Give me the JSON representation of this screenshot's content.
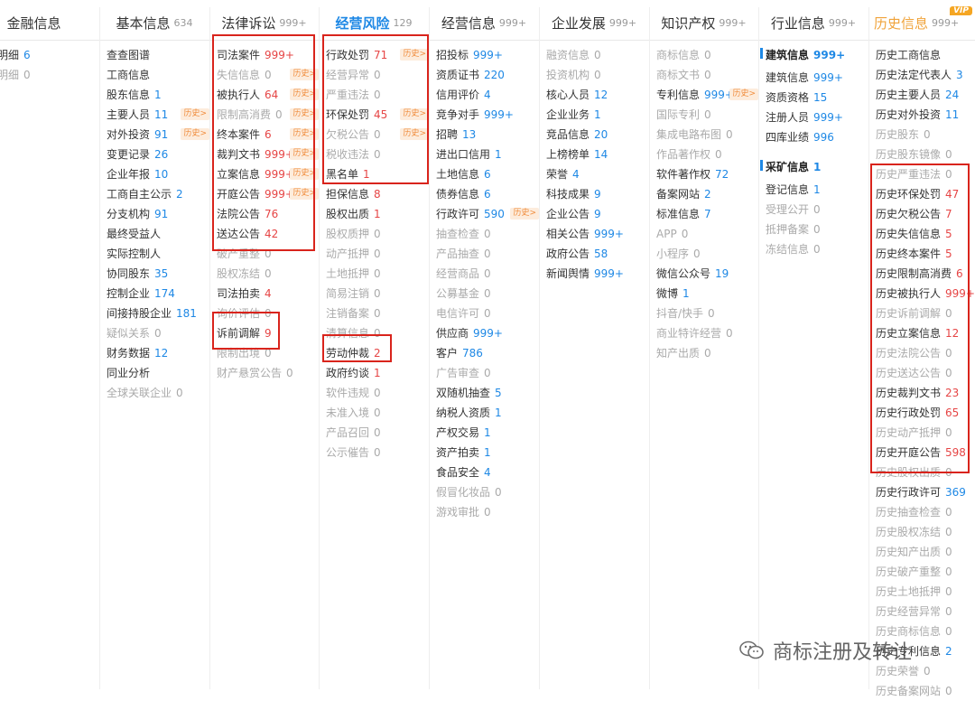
{
  "tabs": [
    {
      "label": "金融信息",
      "count": "",
      "active": false,
      "hist": false,
      "vip": ""
    },
    {
      "label": "基本信息",
      "count": "634",
      "active": false,
      "hist": false,
      "vip": ""
    },
    {
      "label": "法律诉讼",
      "count": "999+",
      "active": false,
      "hist": false,
      "vip": ""
    },
    {
      "label": "经营风险",
      "count": "129",
      "active": true,
      "hist": false,
      "vip": ""
    },
    {
      "label": "经营信息",
      "count": "999+",
      "active": false,
      "hist": false,
      "vip": ""
    },
    {
      "label": "企业发展",
      "count": "999+",
      "active": false,
      "hist": false,
      "vip": ""
    },
    {
      "label": "知识产权",
      "count": "999+",
      "active": false,
      "hist": false,
      "vip": ""
    },
    {
      "label": "行业信息",
      "count": "999+",
      "active": false,
      "hist": false,
      "vip": ""
    },
    {
      "label": "历史信息",
      "count": "999+",
      "active": false,
      "hist": true,
      "vip": "VIP"
    }
  ],
  "columns": [
    [
      {
        "name": "债券明细",
        "num": "6",
        "tone": "blue"
      },
      {
        "name": "违约明细",
        "num": "0",
        "dim": true
      }
    ],
    [
      {
        "name": "查查图谱"
      },
      {
        "name": "工商信息"
      },
      {
        "name": "股东信息",
        "num": "1",
        "tone": "blue"
      },
      {
        "name": "主要人员",
        "num": "11",
        "tone": "blue",
        "hist": "历史>"
      },
      {
        "name": "对外投资",
        "num": "91",
        "tone": "blue",
        "hist": "历史>"
      },
      {
        "name": "变更记录",
        "num": "26",
        "tone": "blue"
      },
      {
        "name": "企业年报",
        "num": "10",
        "tone": "blue"
      },
      {
        "name": "工商自主公示",
        "num": "2",
        "tone": "blue"
      },
      {
        "name": "分支机构",
        "num": "91",
        "tone": "blue"
      },
      {
        "name": "最终受益人"
      },
      {
        "name": "实际控制人"
      },
      {
        "name": "协同股东",
        "num": "35",
        "tone": "blue"
      },
      {
        "name": "控制企业",
        "num": "174",
        "tone": "blue"
      },
      {
        "name": "间接持股企业",
        "num": "181",
        "tone": "blue"
      },
      {
        "name": "疑似关系",
        "num": "0",
        "dim": true
      },
      {
        "name": "财务数据",
        "num": "12",
        "tone": "blue"
      },
      {
        "name": "同业分析"
      },
      {
        "name": "全球关联企业",
        "num": "0",
        "dim": true
      }
    ],
    [
      {
        "name": "司法案件",
        "num": "999+",
        "tone": "red"
      },
      {
        "name": "失信信息",
        "num": "0",
        "dim": true,
        "hist": "历史>"
      },
      {
        "name": "被执行人",
        "num": "64",
        "tone": "red",
        "hist": "历史>"
      },
      {
        "name": "限制高消费",
        "num": "0",
        "dim": true,
        "hist": "历史>"
      },
      {
        "name": "终本案件",
        "num": "6",
        "tone": "red",
        "hist": "历史>"
      },
      {
        "name": "裁判文书",
        "num": "999+",
        "tone": "red",
        "hist": "历史>"
      },
      {
        "name": "立案信息",
        "num": "999+",
        "tone": "red",
        "hist": "历史>"
      },
      {
        "name": "开庭公告",
        "num": "999+",
        "tone": "red",
        "hist": "历史>"
      },
      {
        "name": "法院公告",
        "num": "76",
        "tone": "red"
      },
      {
        "name": "送达公告",
        "num": "42",
        "tone": "red"
      },
      {
        "name": "破产重整",
        "num": "0",
        "dim": true
      },
      {
        "name": "股权冻结",
        "num": "0",
        "dim": true
      },
      {
        "name": "司法拍卖",
        "num": "4",
        "tone": "red"
      },
      {
        "name": "询价评估",
        "num": "0",
        "dim": true
      },
      {
        "name": "诉前调解",
        "num": "9",
        "tone": "red"
      },
      {
        "name": "限制出境",
        "num": "0",
        "dim": true
      },
      {
        "name": "财产悬赏公告",
        "num": "0",
        "dim": true
      }
    ],
    [
      {
        "name": "行政处罚",
        "num": "71",
        "tone": "red",
        "hist": "历史>"
      },
      {
        "name": "经营异常",
        "num": "0",
        "dim": true
      },
      {
        "name": "严重违法",
        "num": "0",
        "dim": true
      },
      {
        "name": "环保处罚",
        "num": "45",
        "tone": "red",
        "hist": "历史>"
      },
      {
        "name": "欠税公告",
        "num": "0",
        "dim": true,
        "hist": "历史>"
      },
      {
        "name": "税收违法",
        "num": "0",
        "dim": true
      },
      {
        "name": "黑名单",
        "num": "1",
        "tone": "red"
      },
      {
        "name": "担保信息",
        "num": "8",
        "tone": "red"
      },
      {
        "name": "股权出质",
        "num": "1",
        "tone": "red"
      },
      {
        "name": "股权质押",
        "num": "0",
        "dim": true
      },
      {
        "name": "动产抵押",
        "num": "0",
        "dim": true
      },
      {
        "name": "土地抵押",
        "num": "0",
        "dim": true
      },
      {
        "name": "简易注销",
        "num": "0",
        "dim": true
      },
      {
        "name": "注销备案",
        "num": "0",
        "dim": true
      },
      {
        "name": "清算信息",
        "num": "0",
        "dim": true
      },
      {
        "name": "劳动仲裁",
        "num": "2",
        "tone": "red"
      },
      {
        "name": "政府约谈",
        "num": "1",
        "tone": "red"
      },
      {
        "name": "软件违规",
        "num": "0",
        "dim": true
      },
      {
        "name": "未准入境",
        "num": "0",
        "dim": true
      },
      {
        "name": "产品召回",
        "num": "0",
        "dim": true
      },
      {
        "name": "公示催告",
        "num": "0",
        "dim": true
      }
    ],
    [
      {
        "name": "招投标",
        "num": "999+",
        "tone": "blue"
      },
      {
        "name": "资质证书",
        "num": "220",
        "tone": "blue"
      },
      {
        "name": "信用评价",
        "num": "4",
        "tone": "blue"
      },
      {
        "name": "竞争对手",
        "num": "999+",
        "tone": "blue"
      },
      {
        "name": "招聘",
        "num": "13",
        "tone": "blue"
      },
      {
        "name": "进出口信用",
        "num": "1",
        "tone": "blue"
      },
      {
        "name": "土地信息",
        "num": "6",
        "tone": "blue"
      },
      {
        "name": "债券信息",
        "num": "6",
        "tone": "blue"
      },
      {
        "name": "行政许可",
        "num": "590",
        "tone": "blue",
        "hist": "历史>"
      },
      {
        "name": "抽查检查",
        "num": "0",
        "dim": true
      },
      {
        "name": "产品抽查",
        "num": "0",
        "dim": true
      },
      {
        "name": "经营商品",
        "num": "0",
        "dim": true
      },
      {
        "name": "公募基金",
        "num": "0",
        "dim": true
      },
      {
        "name": "电信许可",
        "num": "0",
        "dim": true
      },
      {
        "name": "供应商",
        "num": "999+",
        "tone": "blue"
      },
      {
        "name": "客户",
        "num": "786",
        "tone": "blue"
      },
      {
        "name": "广告审查",
        "num": "0",
        "dim": true
      },
      {
        "name": "双随机抽查",
        "num": "5",
        "tone": "blue"
      },
      {
        "name": "纳税人资质",
        "num": "1",
        "tone": "blue"
      },
      {
        "name": "产权交易",
        "num": "1",
        "tone": "blue"
      },
      {
        "name": "资产拍卖",
        "num": "1",
        "tone": "blue"
      },
      {
        "name": "食品安全",
        "num": "4",
        "tone": "blue"
      },
      {
        "name": "假冒化妆品",
        "num": "0",
        "dim": true
      },
      {
        "name": "游戏审批",
        "num": "0",
        "dim": true
      }
    ],
    [
      {
        "name": "融资信息",
        "num": "0",
        "dim": true
      },
      {
        "name": "投资机构",
        "num": "0",
        "dim": true
      },
      {
        "name": "核心人员",
        "num": "12",
        "tone": "blue"
      },
      {
        "name": "企业业务",
        "num": "1",
        "tone": "blue"
      },
      {
        "name": "竞品信息",
        "num": "20",
        "tone": "blue"
      },
      {
        "name": "上榜榜单",
        "num": "14",
        "tone": "blue"
      },
      {
        "name": "荣誉",
        "num": "4",
        "tone": "blue"
      },
      {
        "name": "科技成果",
        "num": "9",
        "tone": "blue"
      },
      {
        "name": "企业公告",
        "num": "9",
        "tone": "blue"
      },
      {
        "name": "相关公告",
        "num": "999+",
        "tone": "blue"
      },
      {
        "name": "政府公告",
        "num": "58",
        "tone": "blue"
      },
      {
        "name": "新闻舆情",
        "num": "999+",
        "tone": "blue"
      }
    ],
    [
      {
        "name": "商标信息",
        "num": "0",
        "dim": true
      },
      {
        "name": "商标文书",
        "num": "0",
        "dim": true
      },
      {
        "name": "专利信息",
        "num": "999+",
        "tone": "blue",
        "hist": "历史>"
      },
      {
        "name": "国际专利",
        "num": "0",
        "dim": true
      },
      {
        "name": "集成电路布图",
        "num": "0",
        "dim": true
      },
      {
        "name": "作品著作权",
        "num": "0",
        "dim": true
      },
      {
        "name": "软件著作权",
        "num": "72",
        "tone": "blue"
      },
      {
        "name": "备案网站",
        "num": "2",
        "tone": "blue"
      },
      {
        "name": "标准信息",
        "num": "7",
        "tone": "blue"
      },
      {
        "name": "APP",
        "num": "0",
        "dim": true
      },
      {
        "name": "小程序",
        "num": "0",
        "dim": true
      },
      {
        "name": "微信公众号",
        "num": "19",
        "tone": "blue"
      },
      {
        "name": "微博",
        "num": "1",
        "tone": "blue"
      },
      {
        "name": "抖音/快手",
        "num": "0",
        "dim": true
      },
      {
        "name": "商业特许经营",
        "num": "0",
        "dim": true
      },
      {
        "name": "知产出质",
        "num": "0",
        "dim": true
      }
    ],
    [
      {
        "name": "建筑信息",
        "num": "999+",
        "tone": "blue",
        "sub": true
      },
      {
        "name": "建筑信息",
        "num": "999+",
        "tone": "blue"
      },
      {
        "name": "资质资格",
        "num": "15",
        "tone": "blue"
      },
      {
        "name": "注册人员",
        "num": "999+",
        "tone": "blue"
      },
      {
        "name": "四库业绩",
        "num": "996",
        "tone": "blue"
      },
      {
        "spacer": true
      },
      {
        "name": "采矿信息",
        "num": "1",
        "tone": "blue",
        "sub": true
      },
      {
        "name": "登记信息",
        "num": "1",
        "tone": "blue"
      },
      {
        "name": "受理公开",
        "num": "0",
        "dim": true
      },
      {
        "name": "抵押备案",
        "num": "0",
        "dim": true
      },
      {
        "name": "冻结信息",
        "num": "0",
        "dim": true
      }
    ],
    [
      {
        "name": "历史工商信息"
      },
      {
        "name": "历史法定代表人",
        "num": "3",
        "tone": "blue"
      },
      {
        "name": "历史主要人员",
        "num": "24",
        "tone": "blue"
      },
      {
        "name": "历史对外投资",
        "num": "11",
        "tone": "blue"
      },
      {
        "name": "历史股东",
        "num": "0",
        "dim": true
      },
      {
        "name": "历史股东镜像",
        "num": "0",
        "dim": true
      },
      {
        "name": "历史严重违法",
        "num": "0",
        "dim": true
      },
      {
        "name": "历史环保处罚",
        "num": "47",
        "tone": "red"
      },
      {
        "name": "历史欠税公告",
        "num": "7",
        "tone": "red"
      },
      {
        "name": "历史失信信息",
        "num": "5",
        "tone": "red"
      },
      {
        "name": "历史终本案件",
        "num": "5",
        "tone": "red"
      },
      {
        "name": "历史限制高消费",
        "num": "6",
        "tone": "red"
      },
      {
        "name": "历史被执行人",
        "num": "999+",
        "tone": "red"
      },
      {
        "name": "历史诉前调解",
        "num": "0",
        "dim": true
      },
      {
        "name": "历史立案信息",
        "num": "12",
        "tone": "red"
      },
      {
        "name": "历史法院公告",
        "num": "0",
        "dim": true
      },
      {
        "name": "历史送达公告",
        "num": "0",
        "dim": true
      },
      {
        "name": "历史裁判文书",
        "num": "23",
        "tone": "red"
      },
      {
        "name": "历史行政处罚",
        "num": "65",
        "tone": "red"
      },
      {
        "name": "历史动产抵押",
        "num": "0",
        "dim": true
      },
      {
        "name": "历史开庭公告",
        "num": "598",
        "tone": "red"
      },
      {
        "name": "历史股权出质",
        "num": "0",
        "dim": true
      },
      {
        "name": "历史行政许可",
        "num": "369",
        "tone": "blue"
      },
      {
        "name": "历史抽查检查",
        "num": "0",
        "dim": true
      },
      {
        "name": "历史股权冻结",
        "num": "0",
        "dim": true
      },
      {
        "name": "历史知产出质",
        "num": "0",
        "dim": true
      },
      {
        "name": "历史破产重整",
        "num": "0",
        "dim": true
      },
      {
        "name": "历史土地抵押",
        "num": "0",
        "dim": true
      },
      {
        "name": "历史经营异常",
        "num": "0",
        "dim": true
      },
      {
        "name": "历史商标信息",
        "num": "0",
        "dim": true
      },
      {
        "name": "历史专利信息",
        "num": "2",
        "tone": "blue"
      },
      {
        "name": "历史荣誉",
        "num": "0",
        "dim": true
      },
      {
        "name": "历史备案网站",
        "num": "0",
        "dim": true
      }
    ]
  ],
  "watermark": {
    "text": "商标注册及转让",
    "icon": "wechat-icon"
  }
}
